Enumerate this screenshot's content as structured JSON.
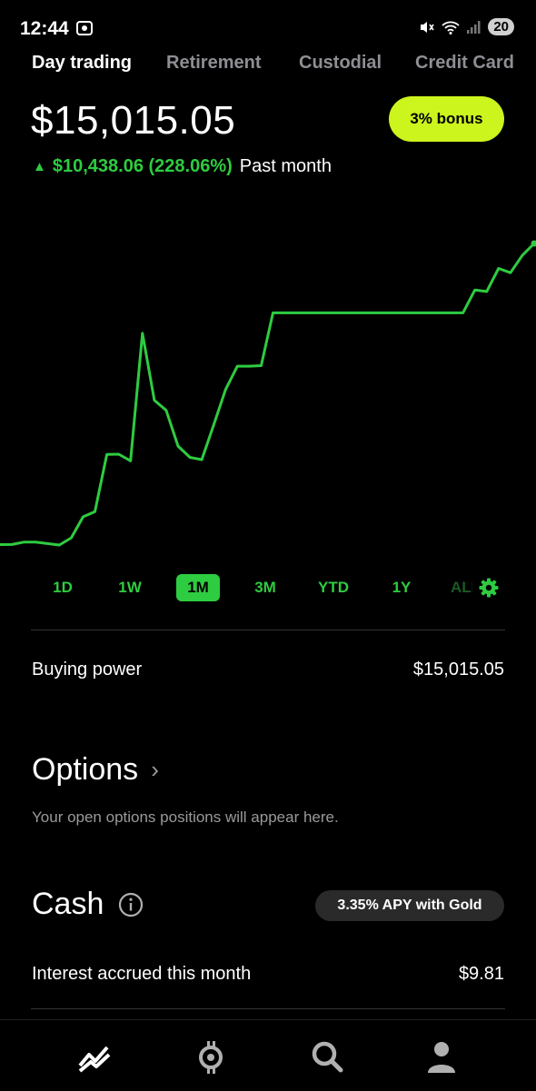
{
  "status_bar": {
    "time": "12:44",
    "battery": "20"
  },
  "tabs": [
    "Day trading",
    "Retirement",
    "Custodial",
    "Credit Card"
  ],
  "account": {
    "balance": "$15,015.05",
    "bonus_label": "3% bonus",
    "change": "$10,438.06 (228.06%)",
    "period": "Past month"
  },
  "chart_data": {
    "type": "line",
    "x": [
      0,
      1,
      2,
      3,
      4,
      5,
      6,
      7,
      8,
      9,
      10,
      11,
      12,
      13,
      14,
      15,
      16,
      17,
      18,
      19,
      20,
      21,
      22,
      23,
      24,
      25,
      26,
      27,
      28,
      29,
      30,
      31,
      32,
      33,
      34,
      35,
      36,
      37,
      38,
      39,
      40,
      41,
      42,
      43,
      44,
      45
    ],
    "values": [
      4577,
      4580,
      4660,
      4660,
      4610,
      4560,
      4810,
      5540,
      5720,
      7700,
      7710,
      7480,
      11900,
      9580,
      9230,
      7990,
      7600,
      7520,
      8720,
      9950,
      10760,
      10760,
      10780,
      12610,
      12610,
      12610,
      12610,
      12610,
      12610,
      12610,
      12610,
      12610,
      12610,
      12610,
      12610,
      12610,
      12610,
      12610,
      12610,
      12610,
      13400,
      13350,
      14150,
      14000,
      14600,
      15015.05
    ],
    "series_color": "#2ecc40"
  },
  "ranges": [
    "1D",
    "1W",
    "1M",
    "3M",
    "YTD",
    "1Y",
    "ALL"
  ],
  "buying_power": {
    "label": "Buying power",
    "value": "$15,015.05"
  },
  "options": {
    "title": "Options",
    "subtitle": "Your open options positions will appear here."
  },
  "cash": {
    "title": "Cash",
    "apy_label": "3.35% APY with Gold",
    "interest_label": "Interest accrued this month",
    "interest_value": "$9.81"
  },
  "nav": [
    "chart-icon",
    "crypto-icon",
    "search-icon",
    "account-icon"
  ],
  "colors": {
    "accent_green": "#2ecc40",
    "bonus_lime": "#ccf41d",
    "background": "#000000"
  }
}
